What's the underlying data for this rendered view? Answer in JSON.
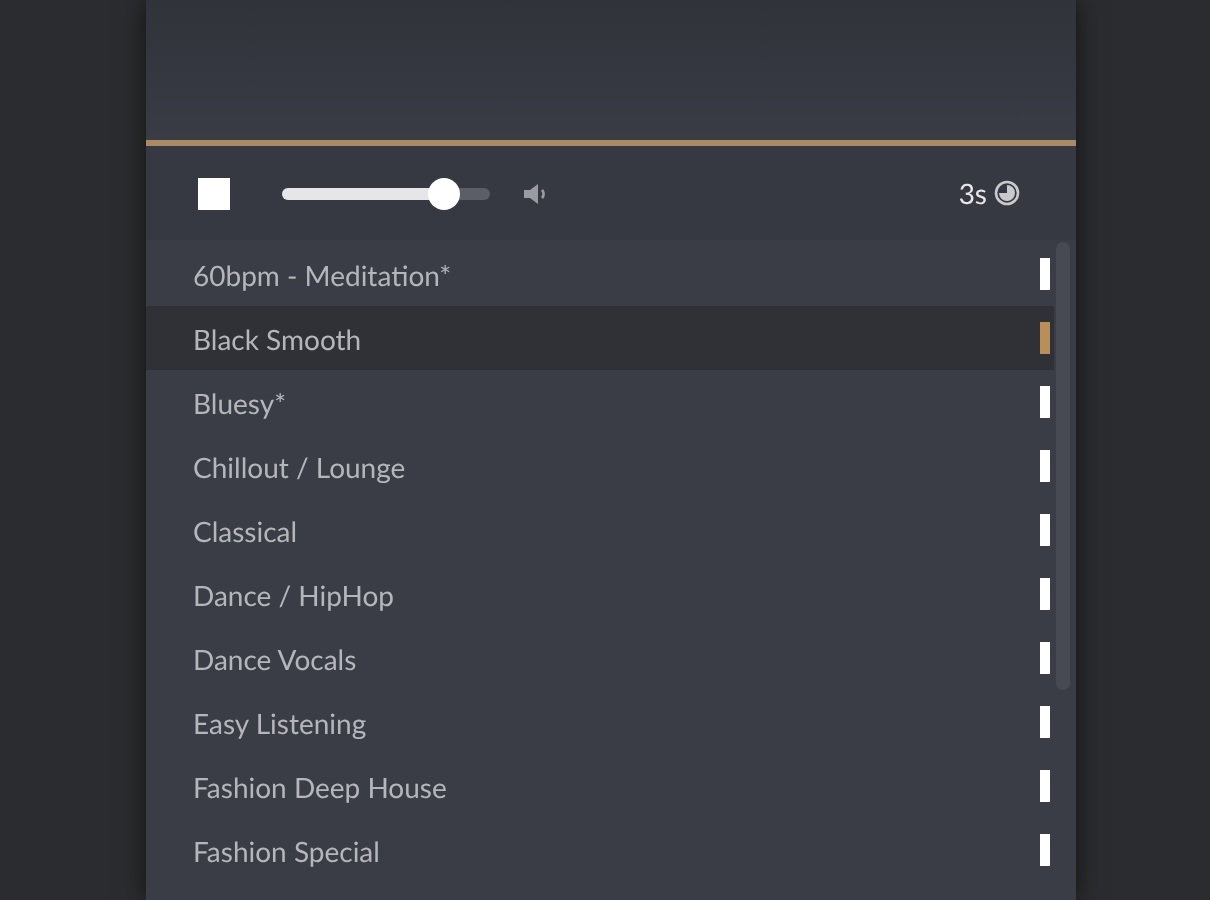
{
  "player": {
    "volume": {
      "level": 0.78
    },
    "timer": "3s"
  },
  "stations": [
    {
      "name": "60bpm - Meditation*",
      "selected": false
    },
    {
      "name": "Black Smooth",
      "selected": true
    },
    {
      "name": "Bluesy*",
      "selected": false
    },
    {
      "name": "Chillout / Lounge",
      "selected": false
    },
    {
      "name": "Classical",
      "selected": false
    },
    {
      "name": "Dance / HipHop",
      "selected": false
    },
    {
      "name": "Dance Vocals",
      "selected": false
    },
    {
      "name": "Easy Listening",
      "selected": false
    },
    {
      "name": "Fashion Deep House",
      "selected": false
    },
    {
      "name": "Fashion Special",
      "selected": false
    }
  ]
}
